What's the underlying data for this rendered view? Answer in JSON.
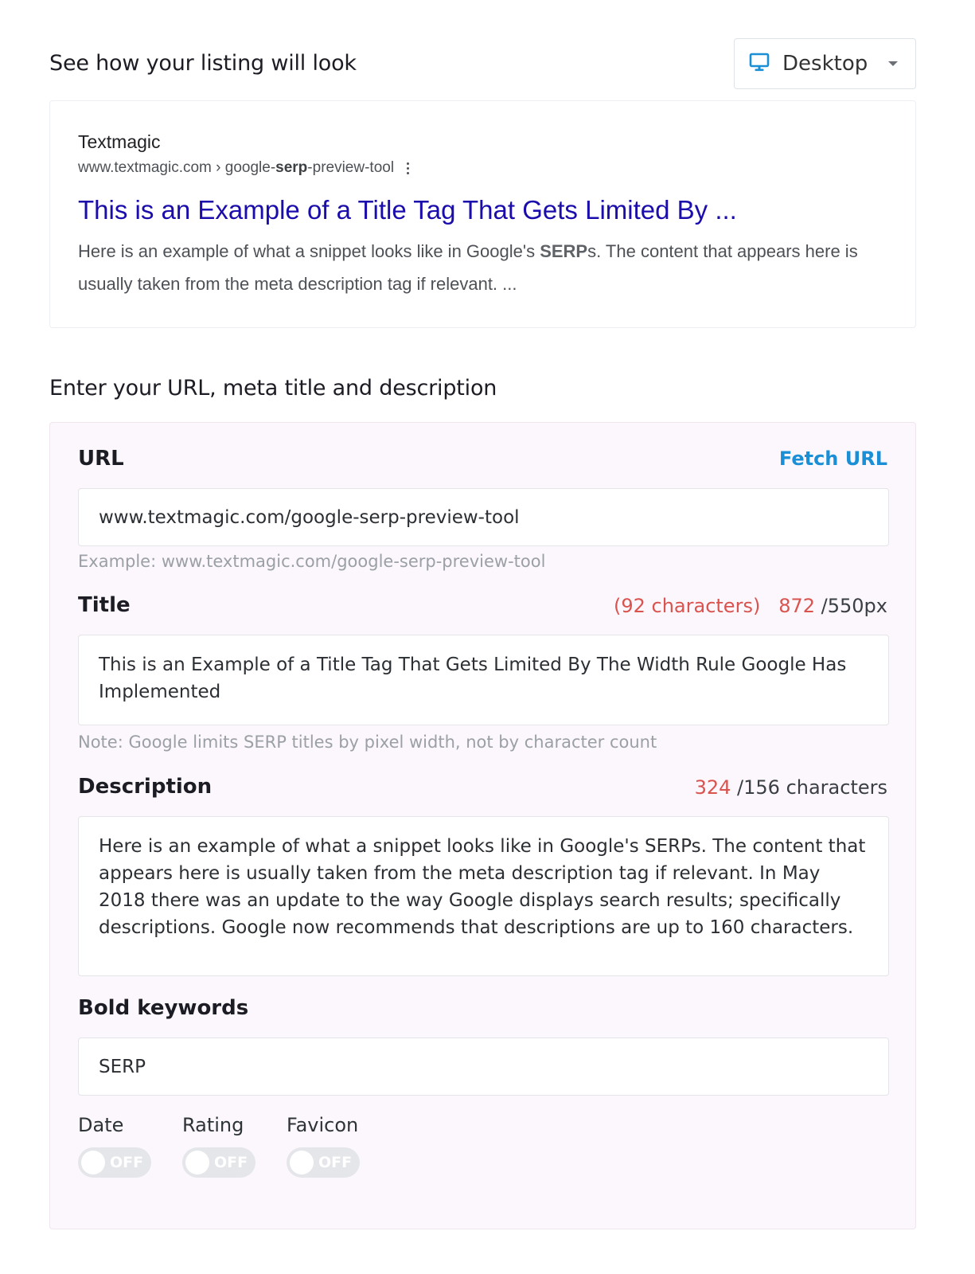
{
  "preview": {
    "heading": "See how your listing will look",
    "device_select": {
      "value": "Desktop",
      "icon": "monitor-icon"
    },
    "serp": {
      "site_name": "Textmagic",
      "url_domain": "www.textmagic.com",
      "url_separator": "›",
      "url_path_prefix": "google-",
      "url_path_bold": "serp",
      "url_path_suffix": "-preview-tool",
      "title": "This is an Example of a Title Tag That Gets Limited By ...",
      "desc_before": "Here is an example of what a snippet looks like in Google's ",
      "desc_bold": "SERP",
      "desc_after": "s. The content that appears here is usually taken from the meta description tag if relevant. ..."
    }
  },
  "form": {
    "heading": "Enter your URL, meta title and description",
    "url": {
      "label": "URL",
      "fetch_label": "Fetch URL",
      "value": "www.textmagic.com/google-serp-preview-tool",
      "hint": "Example: www.textmagic.com/google-serp-preview-tool"
    },
    "title": {
      "label": "Title",
      "char_count": "(92 characters)",
      "px_current": "872",
      "px_limit": "/550px",
      "value": "This is an Example of a Title Tag That Gets Limited By The Width Rule Google Has Implemented",
      "hint": "Note: Google limits SERP titles by pixel width, not by character count"
    },
    "description": {
      "label": "Description",
      "count_current": "324",
      "count_limit": "/156 characters",
      "value": "Here is an example of what a snippet looks like in Google's SERPs. The content that appears here is usually taken from the meta description tag if relevant. In May 2018 there was an update to the way Google displays search results; specifically descriptions. Google now recommends that descriptions are up to 160 characters."
    },
    "bold_keywords": {
      "label": "Bold keywords",
      "value": "SERP"
    },
    "toggles": [
      {
        "label": "Date",
        "state": "OFF"
      },
      {
        "label": "Rating",
        "state": "OFF"
      },
      {
        "label": "Favicon",
        "state": "OFF"
      }
    ]
  },
  "colors": {
    "serp_title": "#1a0dab",
    "link_accent": "#1a8fd6",
    "warning": "#d9534f",
    "panel_bg": "#fcf7fc"
  }
}
